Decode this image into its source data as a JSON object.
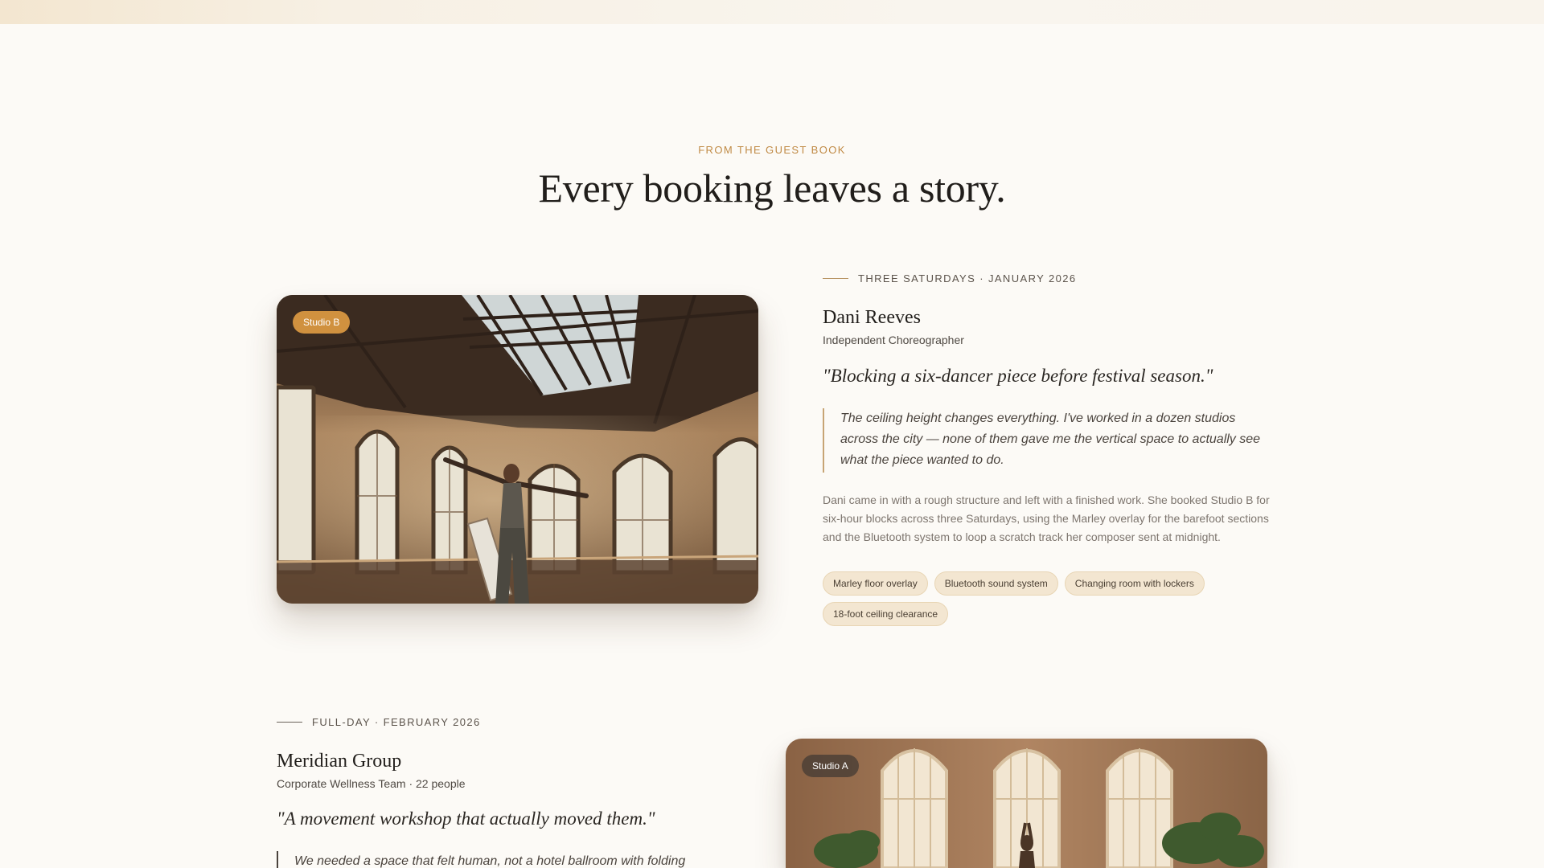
{
  "section": {
    "eyebrow": "FROM THE GUEST BOOK",
    "headline": "Every booking leaves a story."
  },
  "stories": [
    {
      "studio": "Studio B",
      "meta": "THREE SATURDAYS · JANUARY 2026",
      "name": "Dani Reeves",
      "role": "Independent Choreographer",
      "pullquote": "\"Blocking a six-dancer piece before festival season.\"",
      "blockquote": "The ceiling height changes everything. I've worked in a dozen studios across the city — none of them gave me the vertical space to actually see what the piece wanted to do.",
      "body": "Dani came in with a rough structure and left with a finished work. She booked Studio B for six-hour blocks across three Saturdays, using the Marley overlay for the barefoot sections and the Bluetooth system to loop a scratch track her composer sent at midnight.",
      "tags": [
        "Marley floor overlay",
        "Bluetooth sound system",
        "Changing room with lockers",
        "18-foot ceiling clearance"
      ],
      "image": "dancer-in-loft-studio"
    },
    {
      "studio": "Studio A",
      "meta": "FULL-DAY · FEBRUARY 2026",
      "name": "Meridian Group",
      "role": "Corporate Wellness Team · 22 people",
      "pullquote": "\"A movement workshop that actually moved them.\"",
      "blockquote": "We needed a space that felt human, not a hotel ballroom with folding",
      "image": "yoga-studio-arched-windows"
    }
  ],
  "colors": {
    "background": "#fcfaf6",
    "accent": "#c08a45",
    "tag_bg": "#f3e6d1"
  }
}
